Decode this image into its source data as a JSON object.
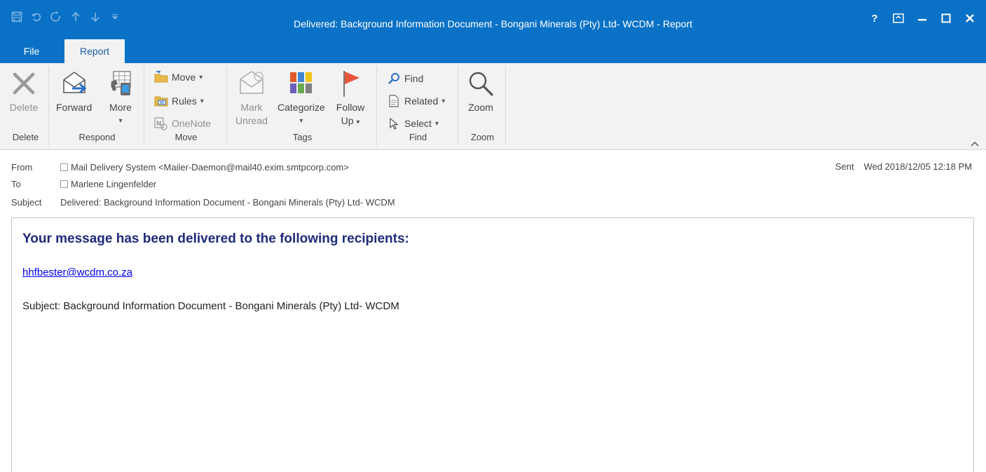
{
  "window": {
    "title": "Delivered: Background Information Document - Bongani Minerals (Pty) Ltd- WCDM - Report",
    "controls": [
      "?",
      "⊡",
      "–",
      "☐",
      "✕"
    ]
  },
  "tabs": {
    "file": "File",
    "report": "Report"
  },
  "ribbon": {
    "delete_group": {
      "label": "Delete",
      "delete": "Delete"
    },
    "respond_group": {
      "label": "Respond",
      "forward": "Forward",
      "more": "More"
    },
    "move_group": {
      "label": "Move",
      "move": "Move",
      "rules": "Rules",
      "onenote": "OneNote"
    },
    "tags_group": {
      "label": "Tags",
      "mark_unread_1": "Mark",
      "mark_unread_2": "Unread",
      "categorize": "Categorize",
      "follow_up_1": "Follow",
      "follow_up_2": "Up"
    },
    "find_group": {
      "label": "Find",
      "find": "Find",
      "related": "Related",
      "select": "Select"
    },
    "zoom_group": {
      "label": "Zoom",
      "zoom": "Zoom"
    }
  },
  "header": {
    "from_label": "From",
    "from_value": "Mail Delivery System <Mailer-Daemon@mail40.exim.smtpcorp.com>",
    "to_label": "To",
    "to_value": "Marlene Lingenfelder",
    "subject_label": "Subject",
    "subject_value": "Delivered: Background Information Document - Bongani Minerals (Pty) Ltd- WCDM",
    "sent_label": "Sent",
    "sent_value": "Wed 2018/12/05 12:18 PM"
  },
  "message": {
    "heading": "Your message has been delivered to the following recipients:",
    "recipient": "hhfbester@wcdm.co.za",
    "subject_line": "Subject: Background Information Document - Bongani Minerals (Pty) Ltd- WCDM"
  },
  "colors": {
    "titlebar": "#0a72c6",
    "ribbon": "#f2f2f2",
    "heading": "#1f2a7a",
    "link": "#0000ee"
  }
}
